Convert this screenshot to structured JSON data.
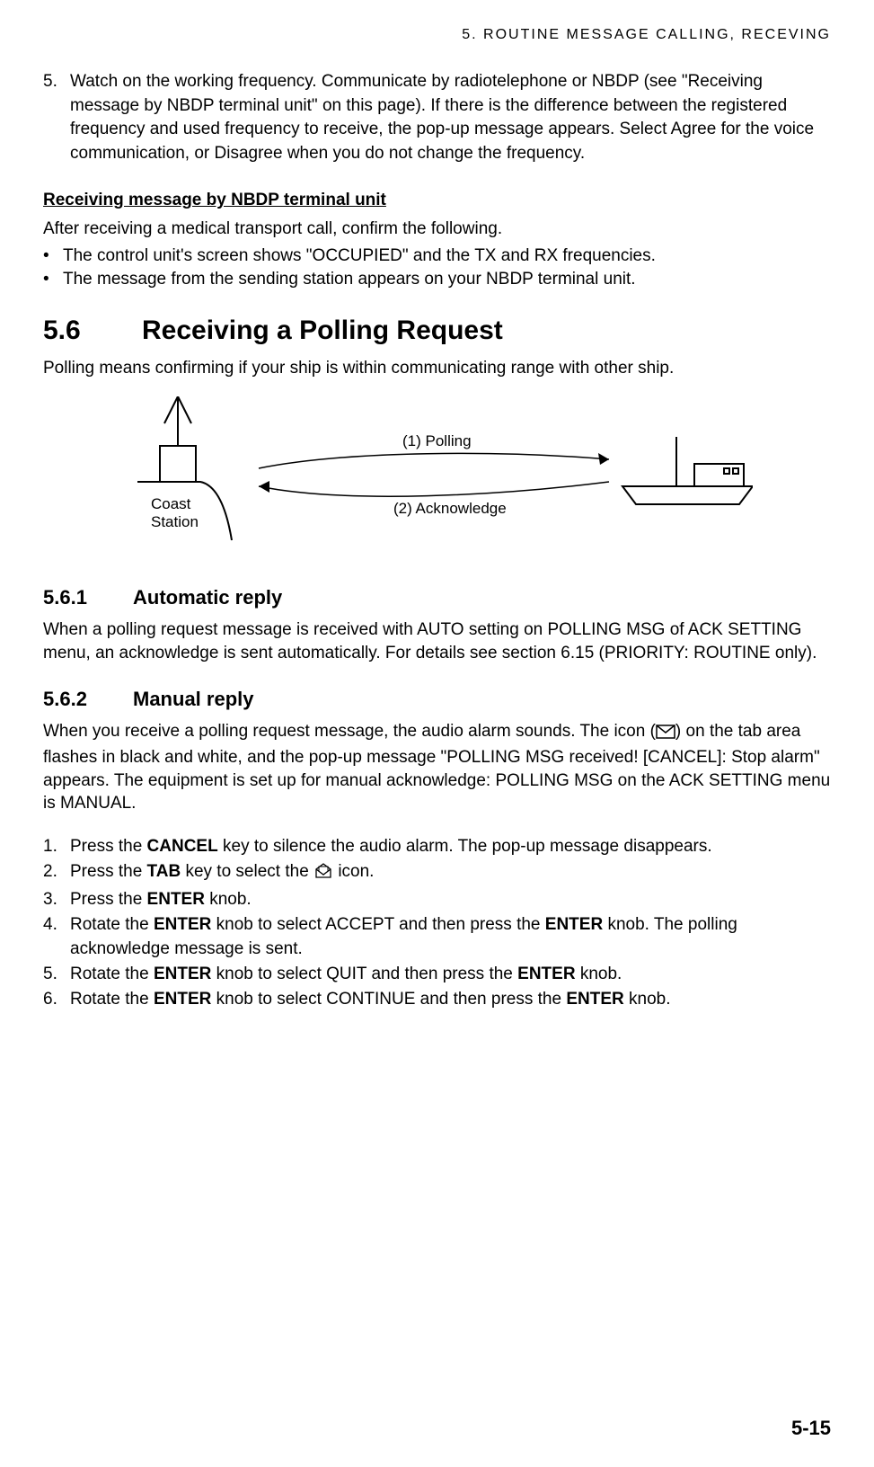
{
  "header": "5.  ROUTINE  MESSAGE  CALLING,  RECEVING",
  "item5": {
    "num": "5.",
    "text": "Watch on the working frequency. Communicate by radiotelephone or NBDP (see \"Receiving message by NBDP terminal unit\" on this page). If there is the difference between the registered frequency and used frequency to receive, the pop-up message appears. Select Agree for the voice communication, or Disagree when you do not change the frequency."
  },
  "subhead1": "Receiving message by NBDP terminal unit",
  "subpara1": "After receiving a medical transport call, confirm the following.",
  "sub_bullets": [
    "The control unit's screen shows \"OCCUPIED\" and the TX and RX frequencies.",
    "The message from the sending station appears on your NBDP terminal unit."
  ],
  "sec56": {
    "num": "5.6",
    "title": "Receiving a Polling Request",
    "intro": "Polling means confirming if your ship is within communicating range with other ship."
  },
  "diagram": {
    "coast_label": "Coast\nStation",
    "line1": "(1) Polling",
    "line2": "(2) Acknowledge"
  },
  "sec561": {
    "num": "5.6.1",
    "title": "Automatic reply",
    "body": "When a polling request message is received with AUTO setting on POLLING MSG of ACK SETTING menu, an acknowledge is sent automatically. For details see section 6.15 (PRIORITY: ROUTINE only)."
  },
  "sec562": {
    "num": "5.6.2",
    "title": "Manual reply",
    "body_a": "When you receive a polling request message, the audio alarm sounds. The icon (",
    "body_b": ") on the tab area flashes in black and white, and the pop-up message \"POLLING MSG received! [CANCEL]: Stop alarm\" appears. The equipment is set up for manual acknowledge: POLLING MSG on the ACK SETTING menu is MANUAL.",
    "steps": [
      {
        "n": "1.",
        "pre": "Press the ",
        "b": "CANCEL",
        "post": " key to silence the audio alarm. The pop-up message disappears."
      },
      {
        "n": "2.",
        "pre": "Press the ",
        "b": "TAB",
        "post": " key to select the ",
        "icon": true,
        "post2": " icon."
      },
      {
        "n": "3.",
        "pre": "Press the ",
        "b": "ENTER",
        "post": " knob."
      },
      {
        "n": "4.",
        "pre": "Rotate the ",
        "b": "ENTER",
        "post": " knob to select ACCEPT and then press the ",
        "b2": "ENTER",
        "post2": " knob. The polling acknowledge message is sent."
      },
      {
        "n": "5.",
        "pre": "Rotate the ",
        "b": "ENTER",
        "post": " knob to select QUIT and then press the ",
        "b2": "ENTER",
        "post2": " knob."
      },
      {
        "n": "6.",
        "pre": "Rotate the ",
        "b": "ENTER",
        "post": " knob to select CONTINUE and then press the ",
        "b2": "ENTER",
        "post2": " knob."
      }
    ]
  },
  "page_number": "5-15"
}
